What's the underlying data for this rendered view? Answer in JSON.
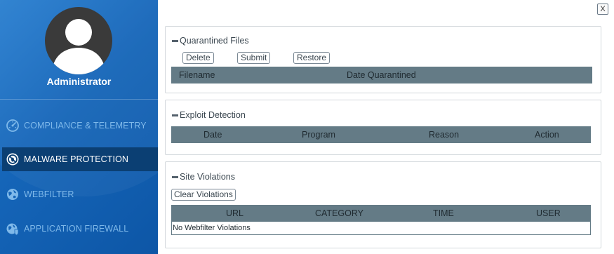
{
  "sidebar": {
    "user_name": "Administrator",
    "items": [
      {
        "label": "COMPLIANCE & TELEMETRY",
        "icon": "speedometer-icon",
        "active": false
      },
      {
        "label": "MALWARE PROTECTION",
        "icon": "no-bug-icon",
        "active": true
      },
      {
        "label": "WEBFILTER",
        "icon": "globe-icon",
        "active": false
      },
      {
        "label": "APPLICATION FIREWALL",
        "icon": "globe-shield-icon",
        "active": false
      }
    ]
  },
  "window": {
    "close_label": "X"
  },
  "quarantined": {
    "title": "Quarantined Files",
    "buttons": {
      "delete": "Delete",
      "submit": "Submit",
      "restore": "Restore"
    },
    "columns": [
      "Filename",
      "Date Quarantined"
    ]
  },
  "exploit": {
    "title": "Exploit Detection",
    "columns": [
      "Date",
      "Program",
      "Reason",
      "Action"
    ]
  },
  "sites": {
    "title": "Site Violations",
    "clear_label": "Clear Violations",
    "columns": [
      "URL",
      "CATEGORY",
      "TIME",
      "USER"
    ],
    "empty_text": "No Webfilter Violations"
  },
  "colors": {
    "sidebar": "#1565b8",
    "active_item": "#0b3f73",
    "table_header": "#647b86"
  }
}
